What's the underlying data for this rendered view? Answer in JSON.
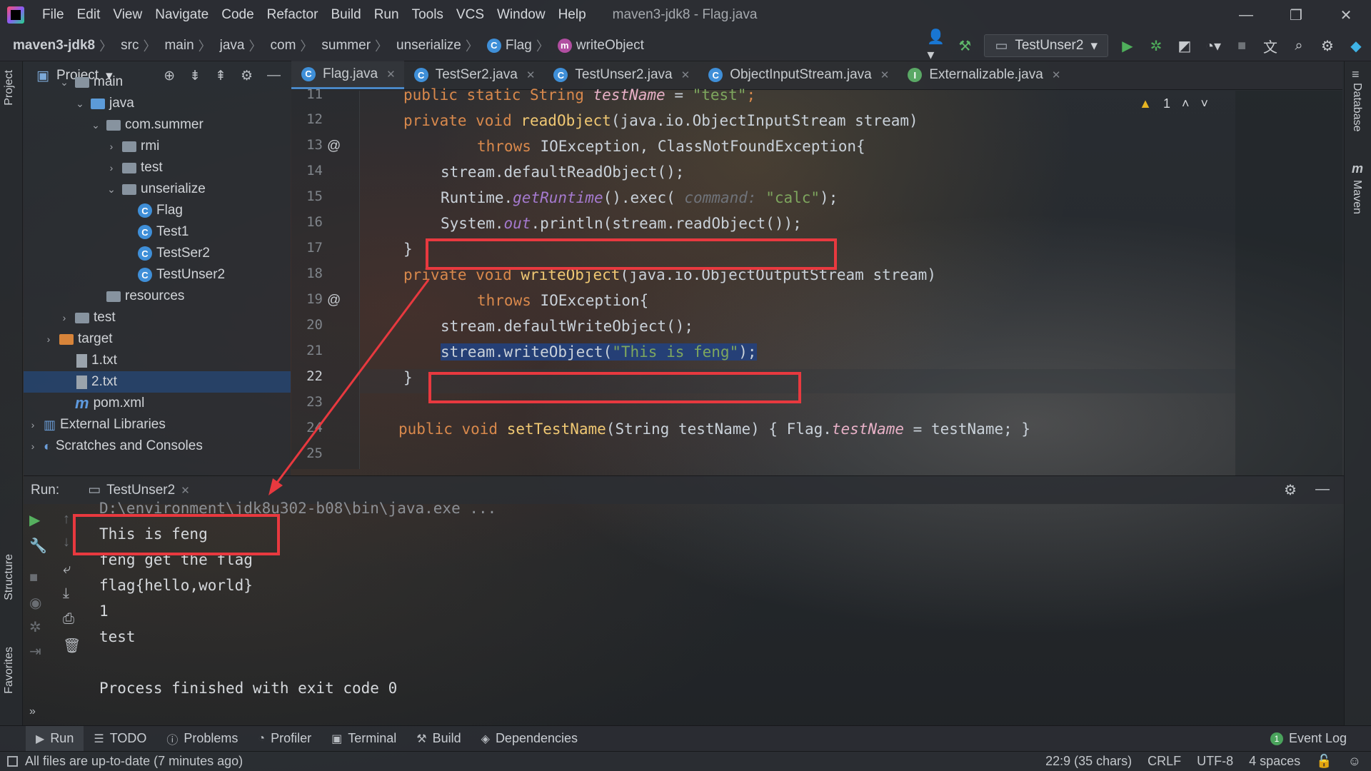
{
  "window": {
    "title": "maven3-jdk8 - Flag.java",
    "menu": [
      "File",
      "Edit",
      "View",
      "Navigate",
      "Code",
      "Refactor",
      "Build",
      "Run",
      "Tools",
      "VCS",
      "Window",
      "Help"
    ],
    "controls": {
      "minimize": "—",
      "restore": "❐",
      "close": "✕"
    }
  },
  "breadcrumb": [
    "maven3-jdk8",
    "src",
    "main",
    "java",
    "com",
    "summer",
    "unserialize",
    "Flag",
    "writeObject"
  ],
  "toolbar": {
    "run_config": "TestUnser2",
    "icons": [
      "user-icon",
      "hammer-icon",
      "run-icon",
      "debug-icon",
      "coverage-icon",
      "profile-icon",
      "stop-icon",
      "translate-icon",
      "search-icon",
      "settings-icon",
      "plugin-icon"
    ]
  },
  "left_stripe": {
    "project": "Project",
    "structure": "Structure",
    "favorites": "Favorites"
  },
  "right_stripe": {
    "database": "Database",
    "maven": "Maven"
  },
  "project_panel": {
    "title": "Project",
    "tree": [
      {
        "label": "main",
        "depth": 2,
        "expanded": true,
        "icon": "folder"
      },
      {
        "label": "java",
        "depth": 3,
        "expanded": true,
        "icon": "source-folder"
      },
      {
        "label": "com.summer",
        "depth": 4,
        "expanded": true,
        "icon": "package"
      },
      {
        "label": "rmi",
        "depth": 5,
        "expanded": false,
        "icon": "package"
      },
      {
        "label": "test",
        "depth": 5,
        "expanded": false,
        "icon": "package"
      },
      {
        "label": "unserialize",
        "depth": 5,
        "expanded": true,
        "icon": "package"
      },
      {
        "label": "Flag",
        "depth": 6,
        "icon": "class"
      },
      {
        "label": "Test1",
        "depth": 6,
        "icon": "class"
      },
      {
        "label": "TestSer2",
        "depth": 6,
        "icon": "class"
      },
      {
        "label": "TestUnser2",
        "depth": 6,
        "icon": "class"
      },
      {
        "label": "resources",
        "depth": 4,
        "icon": "resources-folder"
      },
      {
        "label": "test",
        "depth": 2,
        "expanded": false,
        "icon": "folder"
      },
      {
        "label": "target",
        "depth": 1,
        "expanded": false,
        "icon": "excluded-folder"
      },
      {
        "label": "1.txt",
        "depth": 2,
        "icon": "text-file"
      },
      {
        "label": "2.txt",
        "depth": 2,
        "icon": "text-file",
        "selected": true
      },
      {
        "label": "pom.xml",
        "depth": 2,
        "icon": "maven-file"
      },
      {
        "label": "External Libraries",
        "depth": 0,
        "expanded": false,
        "icon": "library"
      },
      {
        "label": "Scratches and Consoles",
        "depth": 0,
        "expanded": false,
        "icon": "scratches"
      }
    ]
  },
  "editor_tabs": [
    {
      "label": "Flag.java",
      "icon": "C",
      "active": true
    },
    {
      "label": "TestSer2.java",
      "icon": "C"
    },
    {
      "label": "TestUnser2.java",
      "icon": "C"
    },
    {
      "label": "ObjectInputStream.java",
      "icon": "C"
    },
    {
      "label": "Externalizable.java",
      "icon": "I"
    }
  ],
  "inspections": {
    "warnings": "1"
  },
  "code": {
    "line_numbers": [
      "11",
      "12",
      "13",
      "14",
      "15",
      "16",
      "17",
      "18",
      "19",
      "20",
      "21",
      "22",
      "23",
      "24",
      "25"
    ],
    "l11": [
      "public static String ",
      "testName",
      " = ",
      "\"test\"",
      ";"
    ],
    "l13": [
      "private void ",
      "readObject",
      "(java.io.ObjectInputStream stream)"
    ],
    "l14": [
      "throws ",
      "IOException, ClassNotFoundException{"
    ],
    "l15": "stream.defaultReadObject();",
    "l16": [
      "Runtime.",
      "getRuntime",
      "().exec( ",
      "command: ",
      "\"calc\"",
      ");"
    ],
    "l17": [
      "System.",
      "out",
      ".println(stream.readObject());"
    ],
    "l18": "}",
    "l19": [
      "private void ",
      "writeObject",
      "(java.io.ObjectOutputStream stream)"
    ],
    "l20": [
      "throws ",
      "IOException{"
    ],
    "l21": "stream.defaultWriteObject();",
    "l22": [
      "stream.writeObject(",
      "\"This is feng\"",
      ");"
    ],
    "l23": "}",
    "l25": [
      "public void ",
      "setTestName",
      "(String testName) { Flag.",
      "testName",
      " = testName; }"
    ]
  },
  "run_panel": {
    "label": "Run:",
    "tab": "TestUnser2",
    "console": [
      "D:\\environment\\jdk8u302-b08\\bin\\java.exe ...",
      "This is feng",
      "feng get the flag",
      "flag{hello,world}",
      "1",
      "test",
      "",
      "Process finished with exit code 0"
    ]
  },
  "bottom_tabs": [
    "Run",
    "TODO",
    "Problems",
    "Profiler",
    "Terminal",
    "Build",
    "Dependencies"
  ],
  "event_log": {
    "label": "Event Log",
    "count": "1"
  },
  "status": {
    "message": "All files are up-to-date (7 minutes ago)",
    "position": "22:9 (35 chars)",
    "line_sep": "CRLF",
    "encoding": "UTF-8",
    "indent": "4 spaces"
  },
  "colors": {
    "highlight_box": "#e8393f",
    "keyword": "#d9894c",
    "method": "#f0c873",
    "string": "#7ea65e",
    "static_field": "#a57acf"
  }
}
